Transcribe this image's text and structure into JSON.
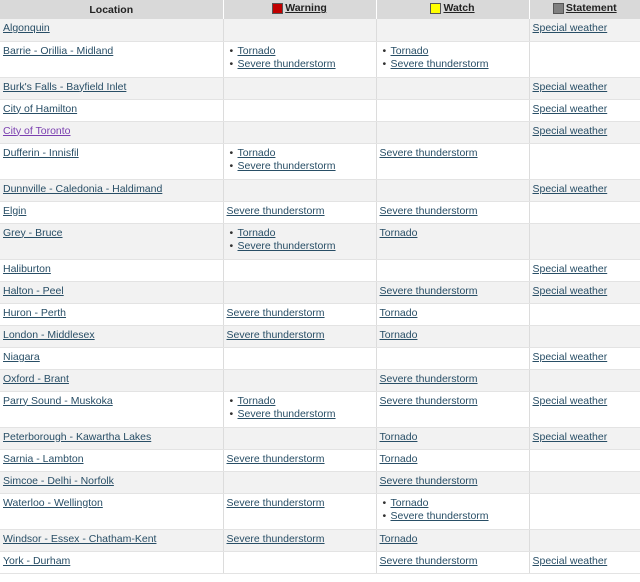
{
  "headers": {
    "location": "Location",
    "warning": "Warning",
    "watch": "Watch",
    "statement": "Statement",
    "warning_color": "#c00000",
    "watch_color": "#ffff00",
    "statement_color": "#808080"
  },
  "rows": [
    {
      "location": "Algonquin",
      "warning": [],
      "watch": [],
      "statement": "Special weather"
    },
    {
      "location": "Barrie - Orillia - Midland",
      "warning": [
        "Tornado",
        "Severe thunderstorm"
      ],
      "watch": [
        "Tornado",
        "Severe thunderstorm"
      ],
      "statement": ""
    },
    {
      "location": "Burk's Falls - Bayfield Inlet",
      "warning": [],
      "watch": [],
      "statement": "Special weather"
    },
    {
      "location": "City of Hamilton",
      "warning": [],
      "watch": [],
      "statement": "Special weather"
    },
    {
      "location": "City of Toronto",
      "warning": [],
      "watch": [],
      "statement": "Special weather",
      "visited": true
    },
    {
      "location": "Dufferin - Innisfil",
      "warning": [
        "Tornado",
        "Severe thunderstorm"
      ],
      "watch": "Severe thunderstorm",
      "statement": ""
    },
    {
      "location": "Dunnville - Caledonia - Haldimand",
      "warning": [],
      "watch": [],
      "statement": "Special weather"
    },
    {
      "location": "Elgin",
      "warning": "Severe thunderstorm",
      "watch": "Severe thunderstorm",
      "statement": ""
    },
    {
      "location": "Grey - Bruce",
      "warning": [
        "Tornado",
        "Severe thunderstorm"
      ],
      "watch": "Tornado",
      "statement": ""
    },
    {
      "location": "Haliburton",
      "warning": [],
      "watch": [],
      "statement": "Special weather"
    },
    {
      "location": "Halton - Peel",
      "warning": [],
      "watch": "Severe thunderstorm",
      "statement": "Special weather"
    },
    {
      "location": "Huron - Perth",
      "warning": "Severe thunderstorm",
      "watch": "Tornado",
      "statement": ""
    },
    {
      "location": "London - Middlesex",
      "warning": "Severe thunderstorm",
      "watch": "Tornado",
      "statement": ""
    },
    {
      "location": "Niagara",
      "warning": [],
      "watch": [],
      "statement": "Special weather"
    },
    {
      "location": "Oxford - Brant",
      "warning": [],
      "watch": "Severe thunderstorm",
      "statement": ""
    },
    {
      "location": "Parry Sound - Muskoka",
      "warning": [
        "Tornado",
        "Severe thunderstorm"
      ],
      "watch": "Severe thunderstorm",
      "statement": "Special weather"
    },
    {
      "location": "Peterborough - Kawartha Lakes",
      "warning": [],
      "watch": "Tornado",
      "statement": "Special weather"
    },
    {
      "location": "Sarnia - Lambton",
      "warning": "Severe thunderstorm",
      "watch": "Tornado",
      "statement": ""
    },
    {
      "location": "Simcoe - Delhi - Norfolk",
      "warning": [],
      "watch": "Severe thunderstorm",
      "statement": ""
    },
    {
      "location": "Waterloo - Wellington",
      "warning": "Severe thunderstorm",
      "watch": [
        "Tornado",
        "Severe thunderstorm"
      ],
      "statement": ""
    },
    {
      "location": "Windsor - Essex - Chatham-Kent",
      "warning": "Severe thunderstorm",
      "watch": "Tornado",
      "statement": ""
    },
    {
      "location": "York - Durham",
      "warning": [],
      "watch": "Severe thunderstorm",
      "statement": "Special weather"
    }
  ]
}
